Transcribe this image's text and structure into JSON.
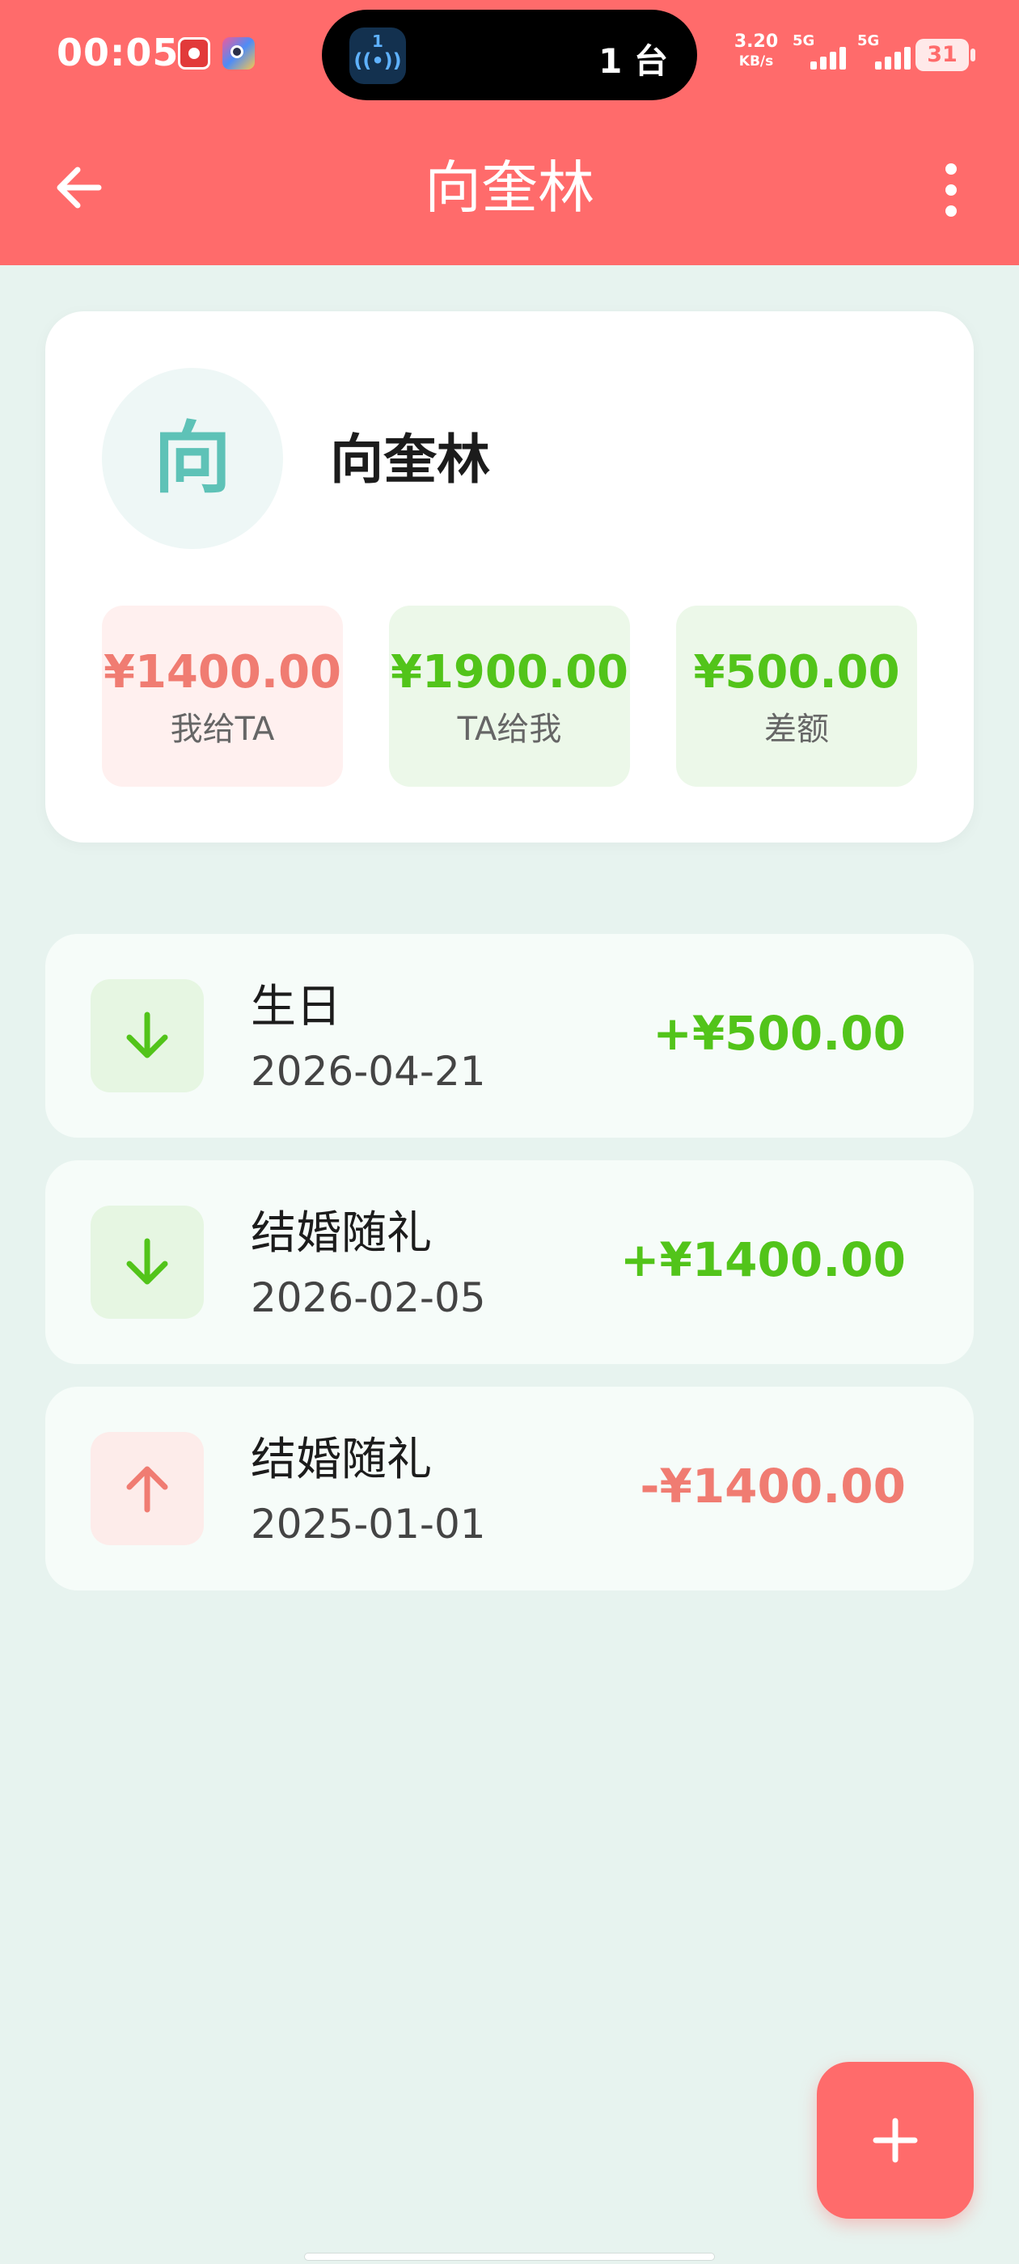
{
  "status_bar": {
    "time": "00:05",
    "island_badge": "1",
    "island_text": "1 台",
    "net_speed_value": "3.20",
    "net_speed_unit": "KB/s",
    "signal1_label": "5G",
    "signal2_label": "5G",
    "battery": "31"
  },
  "header": {
    "title": "向奎林"
  },
  "profile": {
    "avatar_text": "向",
    "name": "向奎林",
    "stats": {
      "give": {
        "value": "¥1400.00",
        "label": "我给TA"
      },
      "get": {
        "value": "¥1900.00",
        "label": "TA给我"
      },
      "diff": {
        "value": "¥500.00",
        "label": "差额"
      }
    }
  },
  "records": [
    {
      "title": "生日",
      "date": "2026-04-21",
      "amount": "+¥500.00",
      "direction": "in"
    },
    {
      "title": "结婚随礼",
      "date": "2026-02-05",
      "amount": "+¥1400.00",
      "direction": "in"
    },
    {
      "title": "结婚随礼",
      "date": "2025-01-01",
      "amount": "-¥1400.00",
      "direction": "out"
    }
  ],
  "colors": {
    "header": "#ff6b6b",
    "income": "#52c41a",
    "expense": "#f07c72",
    "background": "#e7f3ef"
  },
  "icons": {
    "back": "arrow-left-icon",
    "more": "more-vertical-icon",
    "income": "arrow-down-icon",
    "expense": "arrow-up-icon",
    "fab": "plus-icon"
  }
}
